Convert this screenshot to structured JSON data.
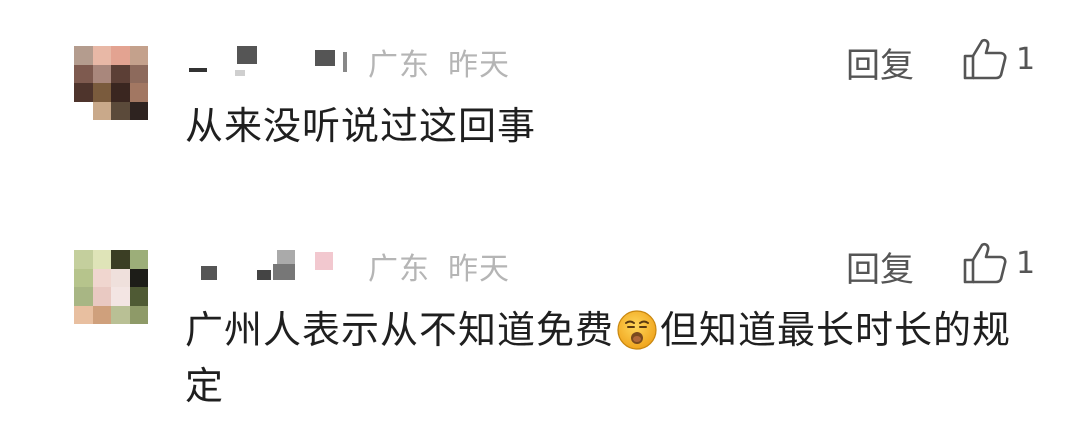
{
  "comments": [
    {
      "location": "广东",
      "time": "昨天",
      "reply_label": "回复",
      "like_count": "1",
      "text": "从来没听说过这回事"
    },
    {
      "location": "广东",
      "time": "昨天",
      "reply_label": "回复",
      "like_count": "1",
      "text_before_emoji": "广州人表示从不知道免费",
      "emoji": "sneezing-face-emoji",
      "text_after_emoji": "但知道最长时长的规定"
    }
  ]
}
